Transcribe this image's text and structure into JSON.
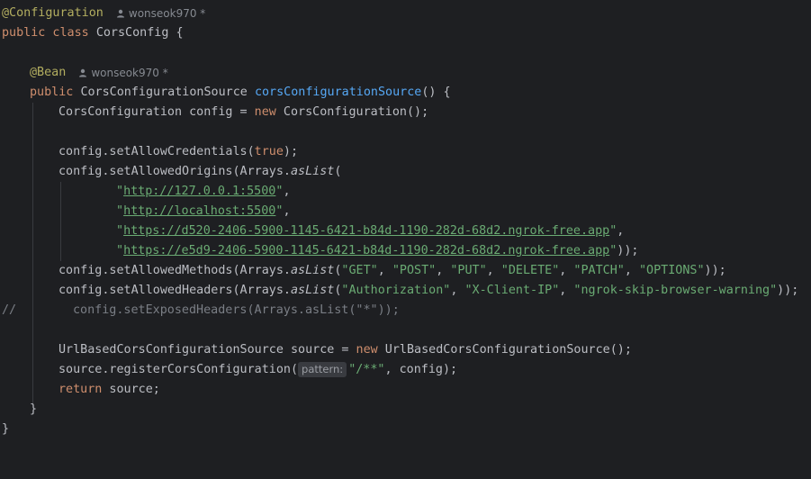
{
  "authors": {
    "class_author": "wonseok970 *",
    "method_author": "wonseok970 *"
  },
  "code": {
    "class_annotation": "@Configuration",
    "class_decl_kw": "public class",
    "class_name": "CorsConfig {",
    "bean_annotation": "@Bean",
    "method_kw": "public",
    "method_type": "CorsConfigurationSource",
    "method_name": "corsConfigurationSource",
    "method_params": "() {",
    "config_decl_type": "CorsConfiguration config = ",
    "kw_new": "new",
    "config_decl_ctor": "CorsConfiguration();",
    "allow_credentials_pre": "config.setAllowCredentials(",
    "kw_true": "true",
    "allow_credentials_post": ");",
    "allowed_origins_pre": "config.setAllowedOrigins(Arrays.",
    "as_list": "asList",
    "open_paren": "(",
    "origins": [
      {
        "url": "http://127.0.0.1:5500",
        "suffix": ","
      },
      {
        "url": "http://localhost:5500",
        "suffix": ","
      },
      {
        "url": "https://d520-2406-5900-1145-6421-b84d-1190-282d-68d2.ngrok-free.app",
        "suffix": ","
      },
      {
        "url": "https://e5d9-2406-5900-1145-6421-b84d-1190-282d-68d2.ngrok-free.app",
        "suffix": "));"
      }
    ],
    "allowed_methods_pre": "config.setAllowedMethods(Arrays.",
    "methods": [
      "\"GET\"",
      "\"POST\"",
      "\"PUT\"",
      "\"DELETE\"",
      "\"PATCH\"",
      "\"OPTIONS\""
    ],
    "allowed_headers_pre": "config.setAllowedHeaders(Arrays.",
    "headers": [
      "\"Authorization\"",
      "\"X-Client-IP\"",
      "\"ngrok-skip-browser-warning\""
    ],
    "list_sep": ", ",
    "close_call": "));",
    "comment_marker": "//",
    "comment_code": "config.setExposedHeaders(Arrays.asList(\"*\"));",
    "source_decl_type": "UrlBasedCorsConfigurationSource source = ",
    "source_ctor": "UrlBasedCorsConfigurationSource();",
    "register_pre": "source.registerCorsConfiguration(",
    "param_hint": "pattern:",
    "register_arg": "\"/**\"",
    "register_post": ", config);",
    "kw_return": "return",
    "return_rest": " source;",
    "close_method": "}",
    "close_class": "}"
  },
  "colors": {
    "background": "#1e1f22",
    "keyword": "#cf8e6d",
    "annotation": "#b3ae60",
    "method_name": "#56a8f5",
    "string": "#6aab73",
    "comment": "#7a7e85",
    "text": "#bcbec4"
  },
  "icons": {
    "author": "user-icon"
  }
}
